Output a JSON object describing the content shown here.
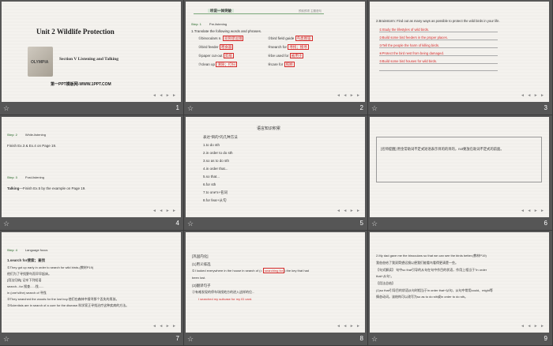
{
  "slides": [
    {
      "num": "1",
      "title": "Unit 2    Wildlife Protection",
      "section": "Section V  Listening and Talking",
      "site": "第一PPT模板网-WWW.1PPT.COM",
      "logo_text": "OLYMPIA"
    },
    {
      "num": "2",
      "tab": "听说一体突破",
      "top_right": "预前预项  主题语句",
      "step_label": "Step",
      "step_num": "1",
      "step_text": "Pre-listening",
      "instr": "1.Translate the following words and phrases.",
      "items": [
        {
          "q": "①binoculars n.",
          "a": "双筒望远镜"
        },
        {
          "q": "②bird field guide",
          "a": "鸟类图鉴"
        },
        {
          "q": "③bird feeder",
          "a": "喂食器"
        },
        {
          "q": "④search for",
          "a": "寻找；搜寻"
        },
        {
          "q": "⑤paper cut-out",
          "a": "剪纸"
        },
        {
          "q": "⑥be used for",
          "a": "被用于"
        },
        {
          "q": "⑦clean up",
          "a": "清除；打扫"
        },
        {
          "q": "⑧care for",
          "a": "照顾"
        }
      ]
    },
    {
      "num": "3",
      "instr": "2.Brainstorm: Find out as many ways as possible to protect the wild birds in your life.",
      "lines": [
        "①Study the lifestyles of wild birds.",
        "②Build some bird feeders in the proper places.",
        "③Tell the people the harm of killing birds.",
        "④Protect the bird nest from being damaged.",
        "⑤Build some bird houses for wild birds."
      ]
    },
    {
      "num": "4",
      "step1_label": "Step",
      "step1_num": "2",
      "step1_text": "While-listening",
      "line1": "Finish Ex.3 & Ex.4 on Page 19.",
      "step2_label": "Step",
      "step2_num": "3",
      "step2_text": "Post-listening",
      "line2_b": "Talking",
      "line2": "—Finish Ex.5 by the example on Page 19."
    },
    {
      "num": "5",
      "title": "语言知识积累",
      "intro": "表达\"目的\"的几种方法",
      "items": [
        "1.to do sth",
        "2.in order to do sth",
        "3.so as to do sth",
        "4.in order that...",
        "5.so that...",
        "6.for sth",
        "7.to one's+名词",
        "8.for fear+从句"
      ]
    },
    {
      "num": "6",
      "text": "[名师提醒]  用金常助词不定式短语表示目的的目的，not要放在助词不定式的前面。"
    },
    {
      "num": "7",
      "step_label": "Step",
      "step_num": "4",
      "step_text": "Language focus",
      "head": "1.search for搜索；查找",
      "lines": [
        "①They got up early in order to search for wild birds.(教材P19)",
        "   他们为了寻找野鸟而早早起床。",
        "[用法归纳]  记牢下列短语",
        "   search...for    搜查......找......",
        "   in (one's/the) search of    寻找",
        "②They searched the woods for the lost boy.他们在森林中搜寻那个丢失的男孩。",
        "③Scientists are in search of a cure for the disease.科学家正寻找治疗这种疾病的方法。"
      ]
    },
    {
      "num": "8",
      "head": "[巩固内化]",
      "lines": [
        "(1)用义排选",
        "①I looked everywhere in the house in search of (=",
        ") the key that had",
        "been lost.",
        "(2)翻译句子",
        "②有难发现的停车场找地方的进入这样的位..."
      ],
      "blank": "searching for",
      "answer": "I searched my suitcase for my ID card."
    },
    {
      "num": "9",
      "lines": [
        "2.My dad gave me the binoculars so that we can see the birds better.(教材P19)",
        "   我爸爸给了我双筒望远镜以便我们能看鸟看得更清楚一些。",
        "【句式解读】   句中so that引导的从句在句中作目的状语，作用上相当于\"in order",
        "   that+从句\"。",
        "【用法总结】",
        "(1)so that引导目的状语从句时相当于in order that+从句，从句中常用could、might等",
        "   情态动词。该结构可以改写为so as to do sth或in order to do sth。"
      ]
    }
  ],
  "nav_symbols": "◄ ◄ ► ►",
  "star": "☆"
}
